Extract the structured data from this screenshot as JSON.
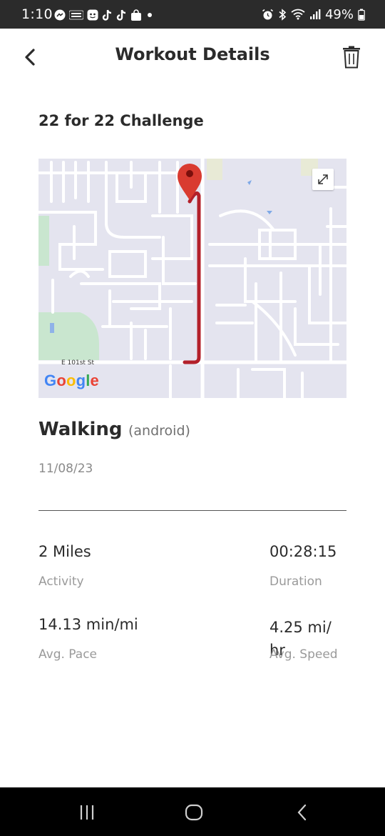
{
  "status_bar": {
    "time": "1:10",
    "battery": "49%",
    "left_icons": [
      "messenger-icon",
      "temu-icon",
      "app-icon",
      "tiktok-icon",
      "tiktok-icon",
      "shopping-bag-icon",
      "dot-icon"
    ],
    "right_icons": [
      "alarm-icon",
      "bluetooth-icon",
      "wifi-icon",
      "signal-icon",
      "battery-icon"
    ]
  },
  "header": {
    "title": "Workout Details",
    "back_icon": "chevron-left-icon",
    "delete_icon": "trash-icon"
  },
  "challenge": {
    "title": "22 for 22 Challenge"
  },
  "map": {
    "street_label": "E 101st St",
    "attribution": "Google",
    "route_color": "#b3202a",
    "pin_color": "#d93b30",
    "expand_icon": "expand-icon"
  },
  "activity": {
    "type": "Walking",
    "source": "(android)",
    "date": "11/08/23"
  },
  "stats": {
    "distance_value": "2 Miles",
    "distance_label": "Activity",
    "duration_value": "00:28:15",
    "duration_label": "Duration",
    "pace_value": "14.13 min/mi",
    "pace_label": "Avg. Pace",
    "speed_value": "4.25 mi/ hr",
    "speed_label": "Avg. Speed"
  },
  "nav": {
    "recents_icon": "recents-icon",
    "home_icon": "home-icon",
    "back_icon": "back-icon"
  }
}
